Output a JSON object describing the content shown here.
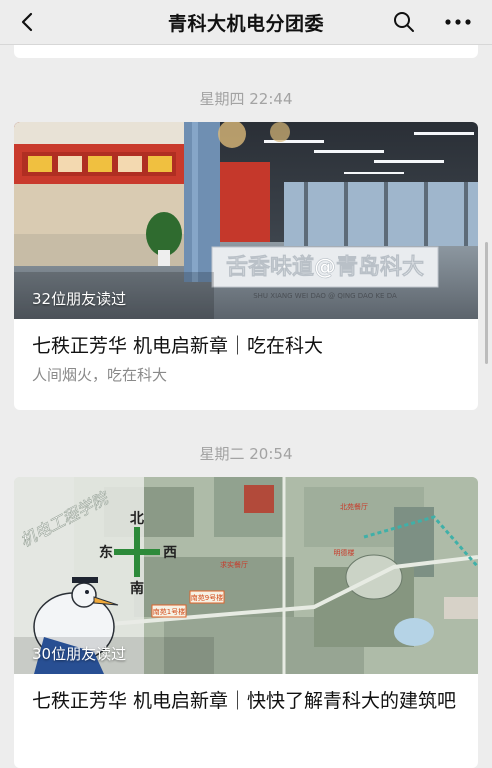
{
  "header": {
    "title": "青科大机电分团委",
    "back_icon": "chevron-left-icon",
    "search_icon": "search-icon",
    "more_icon": "more-horizontal-icon"
  },
  "feed": {
    "items": [
      {
        "timestamp": "星期四 22:44",
        "reads": "32位朋友读过",
        "title": "七秩正芳华 机电启新章｜吃在科大",
        "subtitle": "人间烟火，吃在科大",
        "cover": {
          "sign_text": "舌香味道@青岛科大",
          "sign_pinyin": "SHU XIANG WEI DAO @ QING DAO KE DA"
        }
      },
      {
        "timestamp": "星期二 20:54",
        "reads": "30位朋友读过",
        "title": "七秩正芳华 机电启新章｜快快了解青科大的建筑吧",
        "subtitle": "",
        "cover": {
          "brand_text": "机电工程学院",
          "compass_north": "北",
          "compass_east": "东",
          "compass_west": "西",
          "compass_south": "南",
          "map_labels": [
            "南苑1号楼",
            "南苑9号楼",
            "北苑餐厅",
            "明德楼",
            "求实餐厅"
          ]
        }
      }
    ]
  },
  "colors": {
    "background": "#ededed",
    "card": "#ffffff",
    "timestamp": "#a3a3a3",
    "subtitle": "#8a8a8a"
  }
}
